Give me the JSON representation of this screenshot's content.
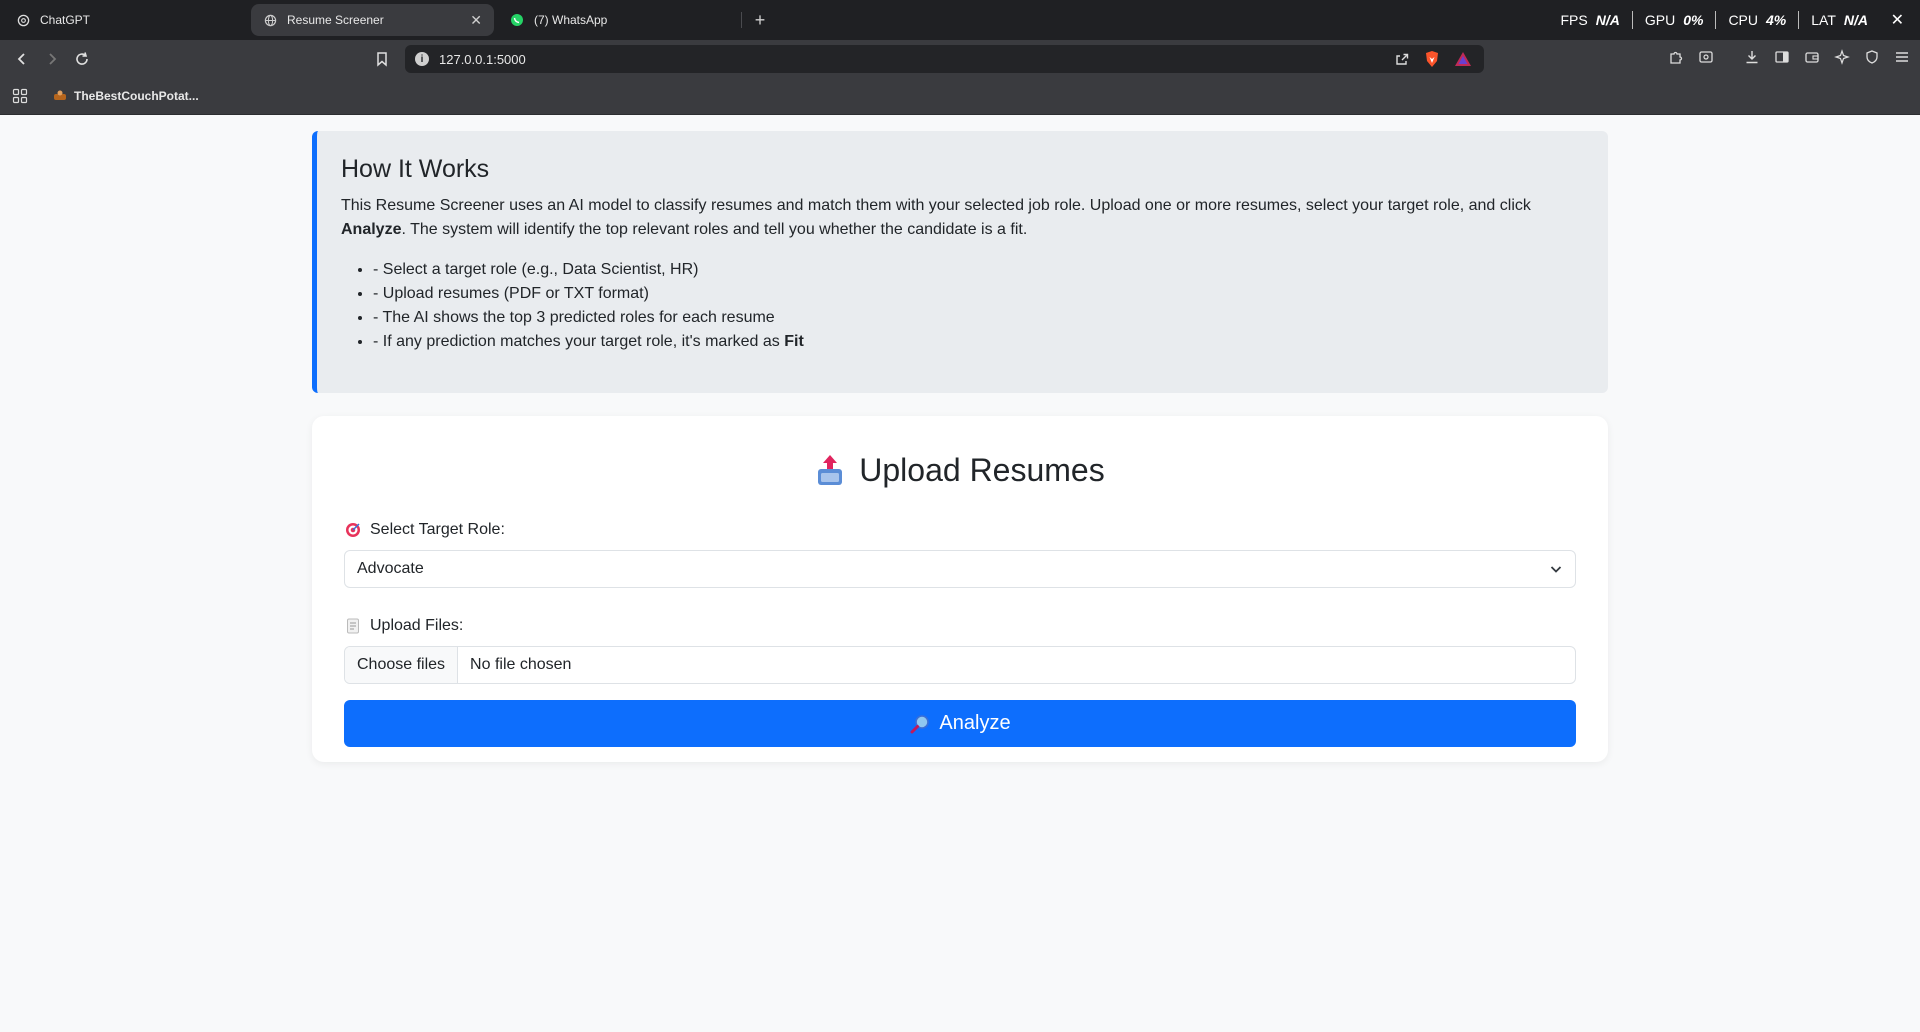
{
  "browser": {
    "tabs": [
      {
        "title": "ChatGPT",
        "icon": "chatgpt-icon",
        "active": false
      },
      {
        "title": "Resume Screener",
        "icon": "globe-icon",
        "active": true
      },
      {
        "title": "(7) WhatsApp",
        "icon": "whatsapp-icon",
        "active": false
      }
    ],
    "new_tab": "+",
    "close_tab": "✕",
    "perf": {
      "fps_label": "FPS",
      "fps_value": "N/A",
      "gpu_label": "GPU",
      "gpu_value": "0%",
      "cpu_label": "CPU",
      "cpu_value": "4%",
      "lat_label": "LAT",
      "lat_value": "N/A"
    },
    "window_close": "✕",
    "url": "127.0.0.1:5000",
    "bookmark": {
      "label": "TheBestCouchPotat...",
      "icon": "couch-potato-icon"
    }
  },
  "info": {
    "title": "How It Works",
    "text_before": "This Resume Screener uses an AI model to classify resumes and match them with your selected job role. Upload one or more resumes, select your target role, and click ",
    "text_bold": "Analyze",
    "text_after": ". The system will identify the top relevant roles and tell you whether the candidate is a fit.",
    "bullets": [
      "- Select a target role (e.g., Data Scientist, HR)",
      "- Upload resumes (PDF or TXT format)",
      "- The AI shows the top 3 predicted roles for each resume"
    ],
    "last_bullet_before": "- If any prediction matches your target role, it's marked as ",
    "last_bullet_bold": "Fit"
  },
  "upload": {
    "title": "Upload Resumes",
    "role_label": "Select Target Role:",
    "role_value": "Advocate",
    "files_label": "Upload Files:",
    "choose_files": "Choose files",
    "no_file": "No file chosen",
    "analyze_label": "Analyze"
  },
  "colors": {
    "accent": "#0d6efd",
    "tabbar": "#1f2023",
    "toolbar": "#3a3b3f",
    "page_bg": "#f8f9fa",
    "info_bg": "#e9ecef"
  }
}
